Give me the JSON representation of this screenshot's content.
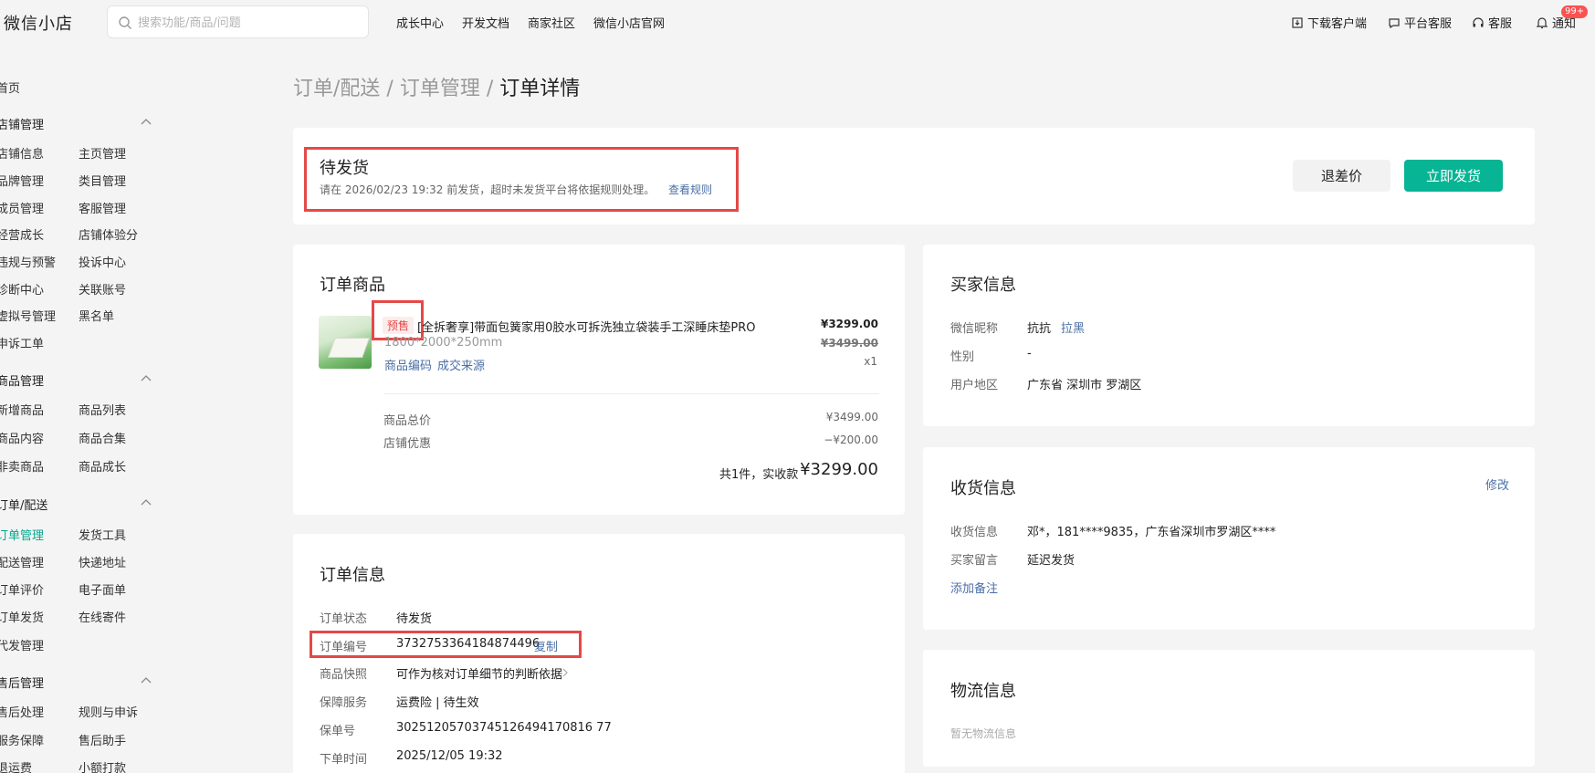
{
  "app": {
    "logo": "微信小店"
  },
  "search": {
    "placeholder": "搜索功能/商品/问题"
  },
  "topnav": [
    "成长中心",
    "开发文档",
    "商家社区",
    "微信小店官网"
  ],
  "topright": {
    "download": "下载客户端",
    "service": "平台客服",
    "support": "客服",
    "notify": "通知",
    "notify_badge": "99+"
  },
  "sidebar": {
    "home": "首页",
    "groups": [
      {
        "title": "店铺管理",
        "items": [
          "店铺信息",
          "主页管理",
          "品牌管理",
          "类目管理",
          "成员管理",
          "客服管理",
          "经营成长",
          "店铺体验分",
          "违规与预警",
          "投诉中心",
          "诊断中心",
          "关联账号",
          "虚拟号管理",
          "黑名单",
          "申诉工单"
        ]
      },
      {
        "title": "商品管理",
        "items": [
          "新增商品",
          "商品列表",
          "商品内容",
          "商品合集",
          "非卖商品",
          "商品成长"
        ]
      },
      {
        "title": "订单/配送",
        "items": [
          "订单管理",
          "发货工具",
          "配送管理",
          "快递地址",
          "订单评价",
          "电子面单",
          "订单发货",
          "在线寄件",
          "代发管理"
        ]
      },
      {
        "title": "售后管理",
        "items": [
          "售后处理",
          "规则与申诉",
          "服务保障",
          "售后助手",
          "退运费",
          "小额打款"
        ]
      }
    ]
  },
  "breadcrumb": {
    "part1": "订单/配送",
    "sep": " / ",
    "part2": "订单管理",
    "current": "订单详情"
  },
  "status": {
    "title": "待发货",
    "desc": "请在 2026/02/23 19:32 前发货，超时未发货平台将依据规则处理。",
    "rule_link": "查看规则",
    "btn_refund": "退差价",
    "btn_ship": "立即发货"
  },
  "goods": {
    "title": "订单商品",
    "tag": "预售",
    "name": "[全拆奢享]带面包簧家用0胶水可拆洗独立袋装手工深睡床垫PRO",
    "spec": "1800*2000*250mm",
    "link_code": "商品编码",
    "link_source": "成交来源",
    "price": "¥3299.00",
    "orig_price": "¥3499.00",
    "qty": "x1",
    "total_label": "商品总价",
    "total_value": "¥3499.00",
    "discount_label": "店铺优惠",
    "discount_value": "−¥200.00",
    "summary_prefix": "共1件，实收款",
    "summary_amount": "¥3299.00"
  },
  "order_info": {
    "title": "订单信息",
    "rows": [
      {
        "label": "订单状态",
        "value": "待发货"
      },
      {
        "label": "订单编号",
        "value": "3732753364184874496",
        "action": "复制"
      },
      {
        "label": "商品快照",
        "value": "可作为核对订单细节的判断依据"
      },
      {
        "label": "保障服务",
        "value": "运费险 | 待生效"
      },
      {
        "label": "保单号",
        "value": "30251205703745126494170816 77"
      },
      {
        "label": "下单时间",
        "value": "2025/12/05 19:32"
      }
    ]
  },
  "buyer": {
    "title": "买家信息",
    "nickname_label": "微信昵称",
    "nickname": "抗抗",
    "block": "拉黑",
    "gender_label": "性别",
    "gender": "-",
    "region_label": "用户地区",
    "region": "广东省 深圳市 罗湖区"
  },
  "shipping": {
    "title": "收货信息",
    "edit": "修改",
    "addr_label": "收货信息",
    "addr": "邓*，181****9835，广东省深圳市罗湖区****",
    "msg_label": "买家留言",
    "msg": "延迟发货",
    "add_note": "添加备注"
  },
  "logistics": {
    "title": "物流信息",
    "empty": "暂无物流信息"
  }
}
